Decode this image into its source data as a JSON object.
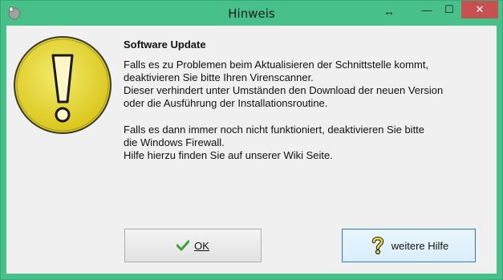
{
  "window": {
    "title": "Hinweis"
  },
  "titlebar": {
    "resize_glyph": "↔",
    "minimize_glyph": "—",
    "maximize_glyph": "☐",
    "close_glyph": "✕",
    "close_color": "#c75050",
    "frame_color": "#48c08a"
  },
  "dialog": {
    "heading": "Software Update",
    "paragraph1": [
      "Falls es zu Problemen beim Aktualisieren der Schnittstelle kommt,",
      "deaktivieren Sie bitte Ihren Virenscanner.",
      "Dieser verhindert unter Umständen den Download der neuen Version",
      "oder die Ausführung der Installationsroutine."
    ],
    "paragraph2": [
      "Falls es dann immer noch nicht funktioniert, deaktivieren Sie bitte",
      "die Windows Firewall.",
      "Hilfe hierzu finden Sie auf unserer Wiki Seite."
    ],
    "warning_icon": "exclamation-icon",
    "warning_color": "#e5d32a"
  },
  "buttons": {
    "ok_label": "OK",
    "ok_icon": "checkmark-icon",
    "help_label": "weitere Hilfe",
    "help_icon": "question-mark-icon"
  }
}
